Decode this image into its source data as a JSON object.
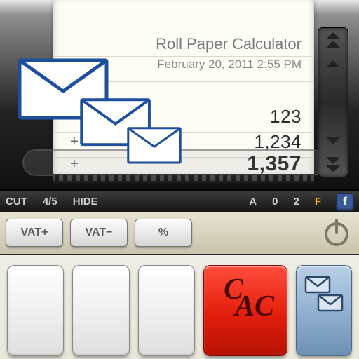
{
  "paper": {
    "title": "Roll Paper Calculator",
    "date": "February 20, 2011 2:55 PM",
    "rows": [
      {
        "op": "",
        "value": "123"
      },
      {
        "op": "+",
        "value": "1,234"
      },
      {
        "op": "+",
        "value": "1,357"
      }
    ]
  },
  "status": {
    "left": [
      "CUT",
      "4/5",
      "HIDE"
    ],
    "right": [
      "A",
      "0",
      "2",
      "F"
    ],
    "selected": "F"
  },
  "keys": {
    "vat_plus": "VAT+",
    "vat_minus": "VAT−",
    "percent": "%",
    "clear_c": "C",
    "clear_ac": "AC"
  },
  "icons": {
    "facebook_letter": "f"
  }
}
